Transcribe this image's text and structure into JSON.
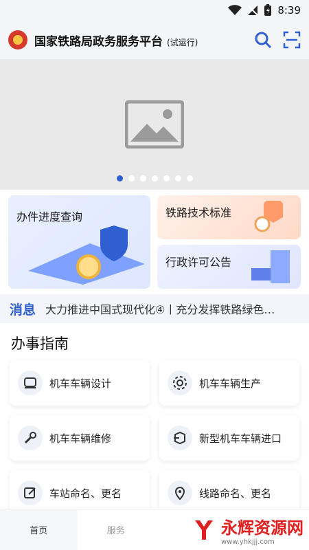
{
  "status": {
    "time": "8:39"
  },
  "header": {
    "title": "国家铁路局政务服务平台",
    "badge": "(试运行)"
  },
  "cards": {
    "big": "办件进度查询",
    "c1": "铁路技术标准",
    "c2": "行政许可公告"
  },
  "news": {
    "tag": "消息",
    "text": "大力推进中国式现代化④丨充分发挥铁路绿色…"
  },
  "guide": {
    "title": "办事指南",
    "items": [
      "机车车辆设计",
      "机车车辆生产",
      "机车车辆维修",
      "新型机车车辆进口",
      "车站命名、更名",
      "线路命名、更名"
    ]
  },
  "tabs": {
    "home": "首页",
    "service": "服务"
  },
  "watermark": {
    "text": "永辉资源网",
    "url": "www.yhkjjj.com"
  },
  "banner": {
    "page": 1,
    "pages": 7
  }
}
